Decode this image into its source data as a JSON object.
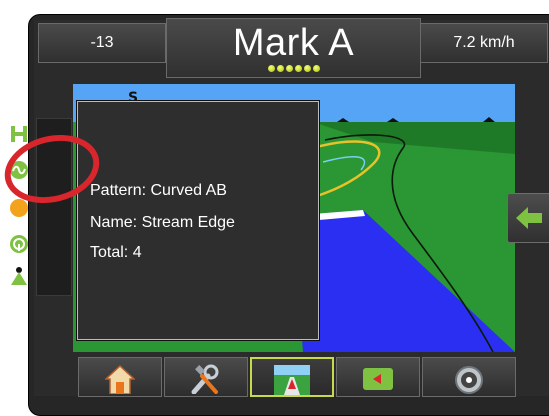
{
  "header": {
    "left_value": "-13",
    "title": "Mark A",
    "right_value": "7.2 km/h",
    "indicator_count": 6
  },
  "map": {
    "compass_letter": "S"
  },
  "popup": {
    "pattern_line": "Pattern: Curved AB",
    "name_line": "Name: Stream Edge",
    "total_line": "Total: 4"
  },
  "side_icons": [
    "guidance-mode-icon",
    "curved-ab-pattern-icon",
    "orange-circle-icon",
    "steering-wheel-icon",
    "vehicle-triangle-icon"
  ],
  "bottom_tabs": [
    "home-icon",
    "tools-icon",
    "guidance-view-icon",
    "field-mark-icon",
    "gauge-icon"
  ],
  "colors": {
    "accent_green": "#7fc241",
    "highlight_ring": "#d9252c",
    "active_tab_border": "#c7d94c",
    "sky": "#56a4f6",
    "field": "#2a9634",
    "coverage": "#2b2ff2"
  }
}
